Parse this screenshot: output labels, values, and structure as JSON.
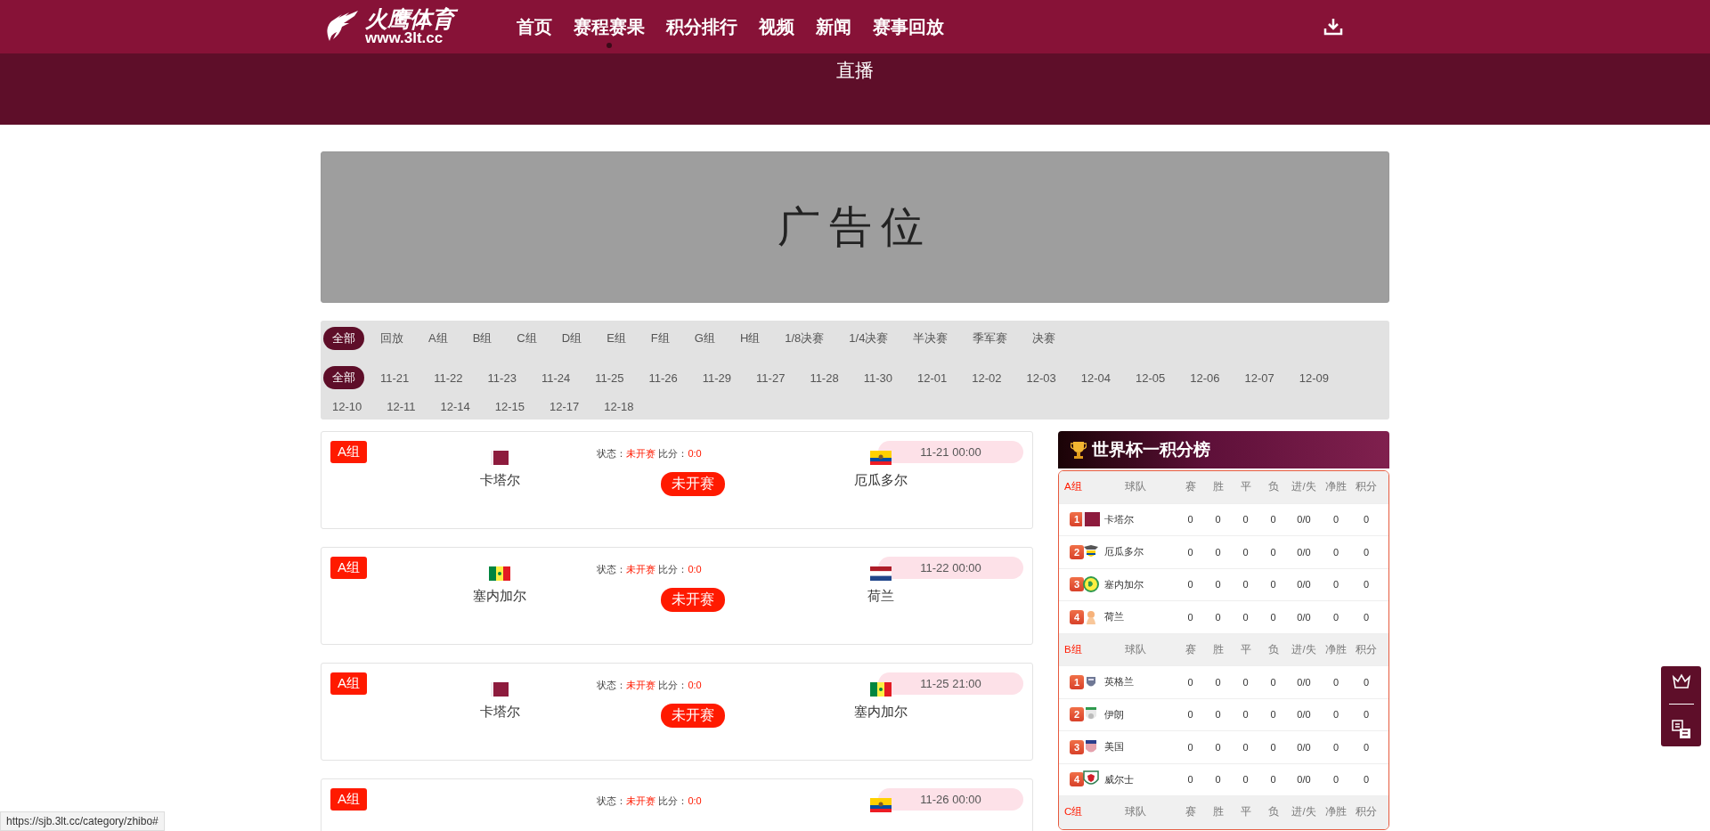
{
  "header": {
    "logo_title": "火鹰体育",
    "logo_url": "www.3lt.cc",
    "nav": [
      {
        "label": "首页",
        "selected": false
      },
      {
        "label": "赛程赛果",
        "selected": true
      },
      {
        "label": "积分排行",
        "selected": false
      },
      {
        "label": "视频",
        "selected": false
      },
      {
        "label": "新闻",
        "selected": false
      },
      {
        "label": "赛事回放",
        "selected": false
      }
    ]
  },
  "page_title": "直播",
  "ad_banner": "广告位",
  "filters": {
    "groups": [
      {
        "label": "全部",
        "selected": true
      },
      {
        "label": "回放",
        "selected": false
      },
      {
        "label": "A组",
        "selected": false
      },
      {
        "label": "B组",
        "selected": false
      },
      {
        "label": "C组",
        "selected": false
      },
      {
        "label": "D组",
        "selected": false
      },
      {
        "label": "E组",
        "selected": false
      },
      {
        "label": "F组",
        "selected": false
      },
      {
        "label": "G组",
        "selected": false
      },
      {
        "label": "H组",
        "selected": false
      },
      {
        "label": "1/8决赛",
        "selected": false
      },
      {
        "label": "1/4决赛",
        "selected": false
      },
      {
        "label": "半决赛",
        "selected": false
      },
      {
        "label": "季军赛",
        "selected": false
      },
      {
        "label": "决赛",
        "selected": false
      }
    ],
    "dates": [
      {
        "label": "全部",
        "selected": true
      },
      {
        "label": "11-21",
        "selected": false
      },
      {
        "label": "11-22",
        "selected": false
      },
      {
        "label": "11-23",
        "selected": false
      },
      {
        "label": "11-24",
        "selected": false
      },
      {
        "label": "11-25",
        "selected": false
      },
      {
        "label": "11-26",
        "selected": false
      },
      {
        "label": "11-29",
        "selected": false
      },
      {
        "label": "11-27",
        "selected": false
      },
      {
        "label": "11-28",
        "selected": false
      },
      {
        "label": "11-30",
        "selected": false
      },
      {
        "label": "12-01",
        "selected": false
      },
      {
        "label": "12-02",
        "selected": false
      },
      {
        "label": "12-03",
        "selected": false
      },
      {
        "label": "12-04",
        "selected": false
      },
      {
        "label": "12-05",
        "selected": false
      },
      {
        "label": "12-06",
        "selected": false
      },
      {
        "label": "12-07",
        "selected": false
      },
      {
        "label": "12-09",
        "selected": false
      },
      {
        "label": "12-10",
        "selected": false
      },
      {
        "label": "12-11",
        "selected": false
      },
      {
        "label": "12-14",
        "selected": false
      },
      {
        "label": "12-15",
        "selected": false
      },
      {
        "label": "12-17",
        "selected": false
      },
      {
        "label": "12-18",
        "selected": false
      }
    ]
  },
  "matches": [
    {
      "group": "A组",
      "status_label": "状态：",
      "status": "未开赛",
      "score_label": "比分：",
      "score": "0:0",
      "time": "11-21 00:00",
      "home": {
        "kind": "qatar",
        "name": "卡塔尔"
      },
      "away": {
        "kind": "ecuador",
        "name": "厄瓜多尔"
      },
      "state_badge": "未开赛"
    },
    {
      "group": "A组",
      "status_label": "状态：",
      "status": "未开赛",
      "score_label": "比分：",
      "score": "0:0",
      "time": "11-22 00:00",
      "home": {
        "kind": "senegal",
        "name": "塞内加尔"
      },
      "away": {
        "kind": "netherlands",
        "name": "荷兰"
      },
      "state_badge": "未开赛"
    },
    {
      "group": "A组",
      "status_label": "状态：",
      "status": "未开赛",
      "score_label": "比分：",
      "score": "0:0",
      "time": "11-25 21:00",
      "home": {
        "kind": "qatar",
        "name": "卡塔尔"
      },
      "away": {
        "kind": "senegal",
        "name": "塞内加尔"
      },
      "state_badge": "未开赛"
    },
    {
      "group": "A组",
      "status_label": "状态：",
      "status": "未开赛",
      "score_label": "比分：",
      "score": "0:0",
      "time": "11-26 00:00",
      "away": {
        "kind": "ecuador"
      }
    }
  ],
  "standings": {
    "title": "世界杯一积分榜",
    "groups": [
      {
        "columns": [
          "A组",
          "球队",
          "赛",
          "胜",
          "平",
          "负",
          "进/失",
          "净胜",
          "积分"
        ],
        "rows": [
          {
            "kind": "qatar",
            "cells": [
              "1",
              "卡塔尔",
              "0",
              "0",
              "0",
              "0",
              "0/0",
              "0",
              "0"
            ]
          },
          {
            "kind": "ecuador",
            "cells": [
              "2",
              "厄瓜多尔",
              "0",
              "0",
              "0",
              "0",
              "0/0",
              "0",
              "0"
            ]
          },
          {
            "kind": "senegal",
            "cells": [
              "3",
              "塞内加尔",
              "0",
              "0",
              "0",
              "0",
              "0/0",
              "0",
              "0"
            ]
          },
          {
            "kind": "netherlands",
            "cells": [
              "4",
              "荷兰",
              "0",
              "0",
              "0",
              "0",
              "0/0",
              "0",
              "0"
            ]
          }
        ]
      },
      {
        "columns": [
          "B组",
          "球队",
          "赛",
          "胜",
          "平",
          "负",
          "进/失",
          "净胜",
          "积分"
        ],
        "rows": [
          {
            "kind": "england",
            "cells": [
              "1",
              "英格兰",
              "0",
              "0",
              "0",
              "0",
              "0/0",
              "0",
              "0"
            ]
          },
          {
            "kind": "iran",
            "cells": [
              "2",
              "伊朗",
              "0",
              "0",
              "0",
              "0",
              "0/0",
              "0",
              "0"
            ]
          },
          {
            "kind": "usa",
            "cells": [
              "3",
              "美国",
              "0",
              "0",
              "0",
              "0",
              "0/0",
              "0",
              "0"
            ]
          },
          {
            "kind": "wales",
            "cells": [
              "4",
              "威尔士",
              "0",
              "0",
              "0",
              "0",
              "0/0",
              "0",
              "0"
            ]
          }
        ]
      },
      {
        "columns": [
          "C组",
          "球队",
          "赛",
          "胜",
          "平",
          "负",
          "进/失",
          "净胜",
          "积分"
        ]
      }
    ]
  },
  "status_url": "https://sjb.3lt.cc/category/zhibo#"
}
